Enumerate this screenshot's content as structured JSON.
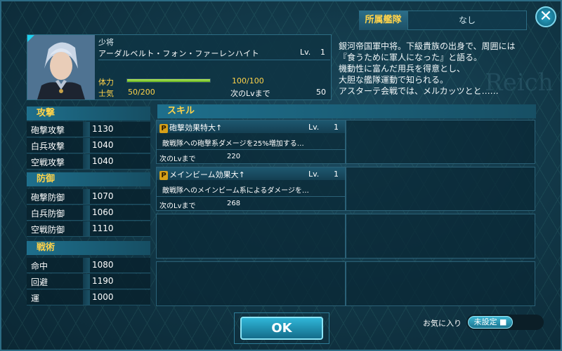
{
  "affiliation": {
    "label": "所属艦隊",
    "value": "なし"
  },
  "close_label": "✕",
  "officer": {
    "rank": "少将",
    "name": "アーダルベルト・フォン・ファーレンハイト",
    "level_label": "Lv.",
    "level": "1",
    "hp_label": "体力",
    "hp_value": "100/100",
    "hp_fraction": 1.0,
    "morale_label": "士気",
    "morale_value": "50/200",
    "next_label": "次のLvまで",
    "next_value": "50",
    "description": [
      "銀河帝国軍中将。下級貴族の出身で、周囲には",
      "『食うために軍人になった』と語る。",
      "機動性に富んだ用兵を得意とし、",
      "大胆な艦隊運動で知られる。",
      "アスターテ会戦では、メルカッツとと……"
    ],
    "watermark": "Reich"
  },
  "stats": {
    "attack": {
      "title": "攻撃",
      "rows": [
        {
          "label": "砲撃攻撃",
          "value": "1130"
        },
        {
          "label": "白兵攻撃",
          "value": "1040"
        },
        {
          "label": "空戦攻撃",
          "value": "1040"
        }
      ]
    },
    "defense": {
      "title": "防御",
      "rows": [
        {
          "label": "砲撃防御",
          "value": "1070"
        },
        {
          "label": "白兵防御",
          "value": "1060"
        },
        {
          "label": "空戦防御",
          "value": "1110"
        }
      ]
    },
    "tactics": {
      "title": "戦術",
      "rows": [
        {
          "label": "命中",
          "value": "1080"
        },
        {
          "label": "回避",
          "value": "1190"
        },
        {
          "label": "運",
          "value": "1000"
        }
      ]
    }
  },
  "skills": {
    "title": "スキル",
    "items": [
      {
        "badge": "P",
        "name": "砲撃効果特大↑",
        "level_label": "Lv.",
        "level": "1",
        "desc": "敵戦隊への砲撃系ダメージを25%増加する…",
        "next_label": "次のLvまで",
        "next_value": "220"
      },
      {
        "badge": "P",
        "name": "メインビーム効果大↑",
        "level_label": "Lv.",
        "level": "1",
        "desc": "敵戦隊へのメインビーム系によるダメージを…",
        "next_label": "次のLvまで",
        "next_value": "268"
      }
    ]
  },
  "ok_label": "OK",
  "favorite": {
    "label": "お気に入り",
    "state": "未設定"
  },
  "colors": {
    "accent": "#ffd34a",
    "panel": "#123848",
    "highlight": "#2fb6d8"
  }
}
